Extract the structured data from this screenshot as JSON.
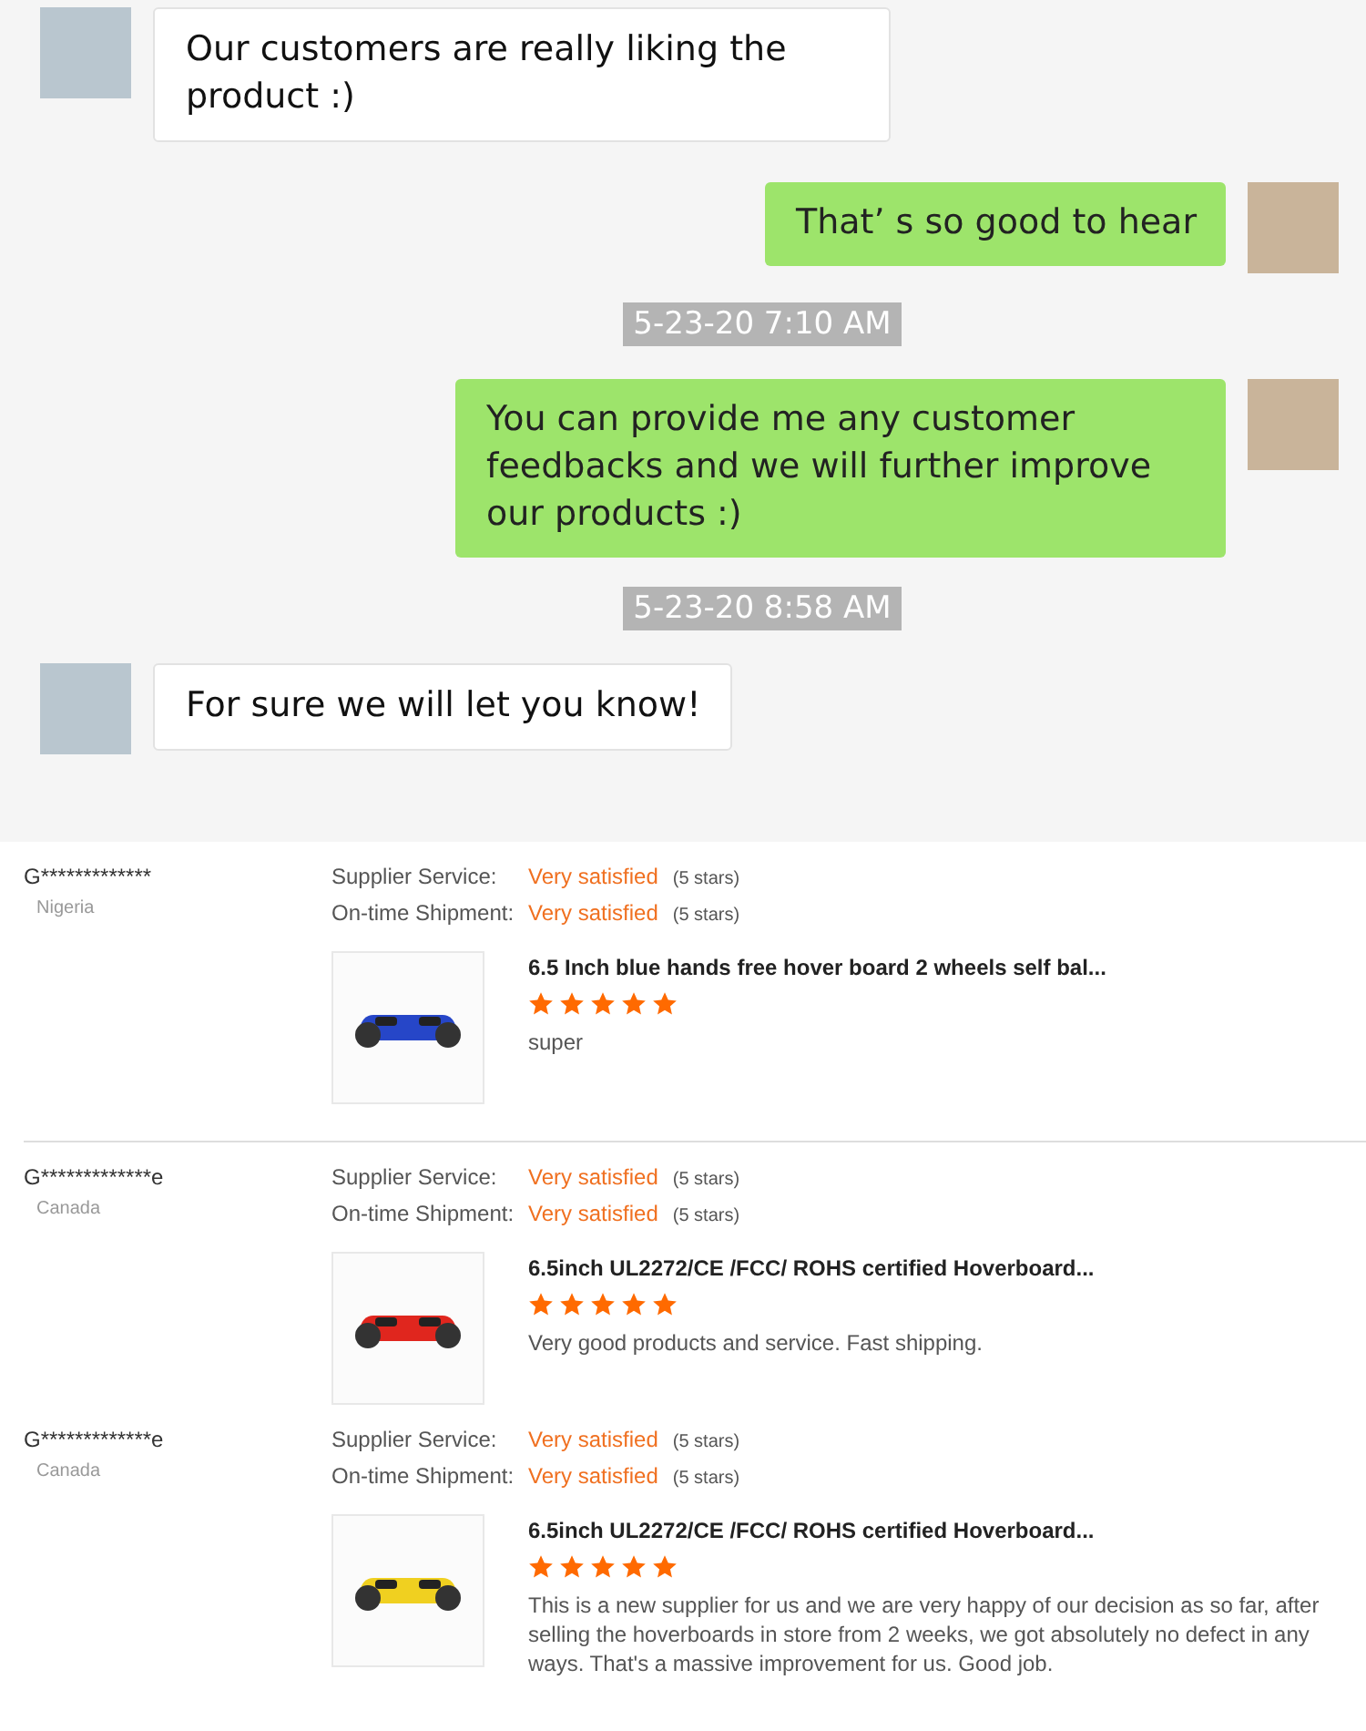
{
  "chat": {
    "messages": [
      {
        "kind": "received",
        "text": "Our customers are really liking the product :)"
      },
      {
        "kind": "sent",
        "text": "That’ s so good to hear"
      },
      {
        "kind": "timestamp",
        "text": "5-23-20 7:10 AM"
      },
      {
        "kind": "sent",
        "text": "You can provide me any customer feedbacks and we will further improve our products :)"
      },
      {
        "kind": "timestamp",
        "text": "5-23-20 8:58 AM"
      },
      {
        "kind": "received",
        "text": "For sure we will let you know!"
      }
    ]
  },
  "reviews": [
    {
      "buyer": "G*************",
      "country": "Nigeria",
      "ratings": [
        {
          "label": "Supplier Service:",
          "value": "Very satisfied",
          "detail": "(5 stars)"
        },
        {
          "label": "On-time Shipment:",
          "value": "Very satisfied",
          "detail": "(5 stars)"
        }
      ],
      "product": {
        "title": "6.5 Inch blue hands free hover board 2 wheels self bal...",
        "color": "#2646c8",
        "stars": 5,
        "comment": "super"
      },
      "divider": true
    },
    {
      "buyer": "G*************e",
      "country": "Canada",
      "ratings": [
        {
          "label": "Supplier Service:",
          "value": "Very satisfied",
          "detail": "(5 stars)"
        },
        {
          "label": "On-time Shipment:",
          "value": "Very satisfied",
          "detail": "(5 stars)"
        }
      ],
      "product": {
        "title": "6.5inch UL2272/CE /FCC/ ROHS certified Hoverboard...",
        "color": "#e0261e",
        "stars": 5,
        "comment": "Very good products and service. Fast shipping."
      },
      "divider": false
    },
    {
      "buyer": "G*************e",
      "country": "Canada",
      "ratings": [
        {
          "label": "Supplier Service:",
          "value": "Very satisfied",
          "detail": "(5 stars)"
        },
        {
          "label": "On-time Shipment:",
          "value": "Very satisfied",
          "detail": "(5 stars)"
        }
      ],
      "product": {
        "title": "6.5inch UL2272/CE /FCC/ ROHS certified Hoverboard...",
        "color": "#f0d020",
        "stars": 5,
        "comment": "This is a new supplier for us and we are very happy of our decision as so far, after selling the hoverboards in store from 2 weeks, we got absolutely no defect in any ways. That's a massive improvement for us. Good job."
      },
      "divider": false
    }
  ]
}
